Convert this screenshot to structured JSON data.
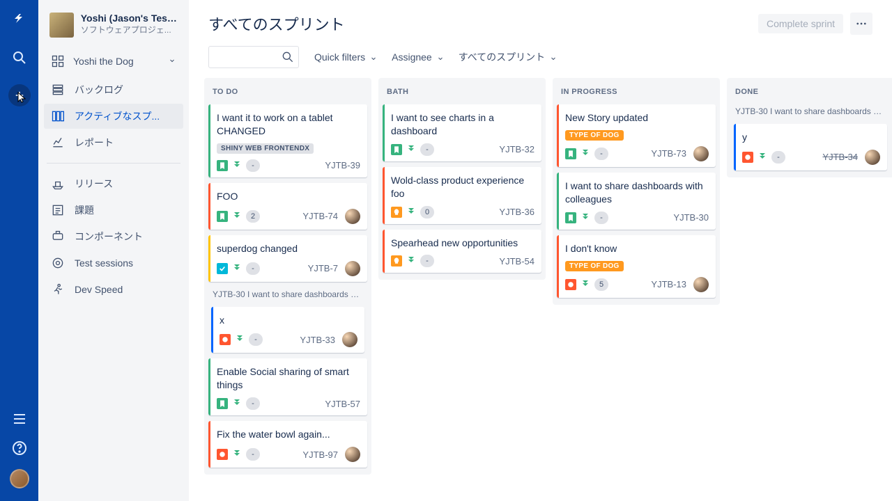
{
  "project": {
    "name": "Yoshi (Jason's Test ...",
    "type": "ソフトウェアプロジェ..."
  },
  "boardSelector": "Yoshi the Dog",
  "nav": {
    "backlog": "バックログ",
    "active": "アクティブなスプ...",
    "reports": "レポート",
    "releases": "リリース",
    "issues": "課題",
    "components": "コンポーネント",
    "tests": "Test sessions",
    "devspeed": "Dev Speed"
  },
  "header": {
    "title": "すべてのスプリント",
    "complete": "Complete sprint"
  },
  "filters": {
    "quick": "Quick filters",
    "assignee": "Assignee",
    "sprint": "すべてのスプリント"
  },
  "search": {
    "placeholder": ""
  },
  "columns": [
    {
      "name": "TO DO",
      "ghost": null,
      "cards": [
        {
          "title": "I want it to work on a tablet CHANGED",
          "stripe": "#36B37E",
          "labels": [
            {
              "text": "SHINY WEB FRONTENDX",
              "style": "default"
            }
          ],
          "type": "story",
          "est": "-",
          "key": "YJTB-39",
          "assignee": false
        },
        {
          "title": "FOO",
          "stripe": "#FF5630",
          "type": "story",
          "est": "2",
          "key": "YJTB-74",
          "assignee": true
        },
        {
          "title": "superdog changed",
          "stripe": "#FFC400",
          "type": "task",
          "est": "-",
          "key": "YJTB-7",
          "assignee": true
        }
      ],
      "ghost2": "YJTB-30 I want to share dashboards wi...",
      "subcards": [
        {
          "title": "x",
          "stripe": "#0065FF",
          "type": "bug",
          "est": "-",
          "key": "YJTB-33",
          "assignee": true
        }
      ],
      "cards2": [
        {
          "title": "Enable Social sharing of smart things",
          "stripe": "#36B37E",
          "type": "story",
          "est": "-",
          "key": "YJTB-57",
          "assignee": false
        },
        {
          "title": "Fix the water bowl again...",
          "stripe": "#FF5630",
          "type": "bug",
          "est": "-",
          "key": "YJTB-97",
          "assignee": true
        }
      ]
    },
    {
      "name": "BATH",
      "cards": [
        {
          "title": "I want to see charts in a dashboard",
          "stripe": "#36B37E",
          "type": "story",
          "est": "-",
          "key": "YJTB-32",
          "assignee": false
        },
        {
          "title": "Wold-class product experience foo",
          "stripe": "#FF5630",
          "type": "idea",
          "est": "0",
          "key": "YJTB-36",
          "assignee": false
        },
        {
          "title": "Spearhead new opportunities",
          "stripe": "#FF5630",
          "type": "idea",
          "est": "-",
          "key": "YJTB-54",
          "assignee": false
        }
      ]
    },
    {
      "name": "IN PROGRESS",
      "cards": [
        {
          "title": "New Story updated",
          "stripe": "#FF5630",
          "labels": [
            {
              "text": "TYPE OF DOG",
              "style": "orange"
            }
          ],
          "type": "story",
          "est": "-",
          "key": "YJTB-73",
          "assignee": true
        },
        {
          "title": "I want to share dashboards with colleagues",
          "stripe": "#36B37E",
          "type": "story",
          "est": "-",
          "key": "YJTB-30",
          "assignee": false
        },
        {
          "title": "I don't know",
          "stripe": "#FF5630",
          "labels": [
            {
              "text": "TYPE OF DOG",
              "style": "orange"
            }
          ],
          "type": "bug",
          "est": "5",
          "key": "YJTB-13",
          "assignee": true
        }
      ]
    },
    {
      "name": "DONE",
      "ghost": "YJTB-30 I want to share dashboards wit...",
      "subcards": [
        {
          "title": "y",
          "stripe": "#0065FF",
          "type": "bug",
          "est": "-",
          "key": "YJTB-34",
          "keyDone": true,
          "assignee": true
        }
      ]
    }
  ]
}
